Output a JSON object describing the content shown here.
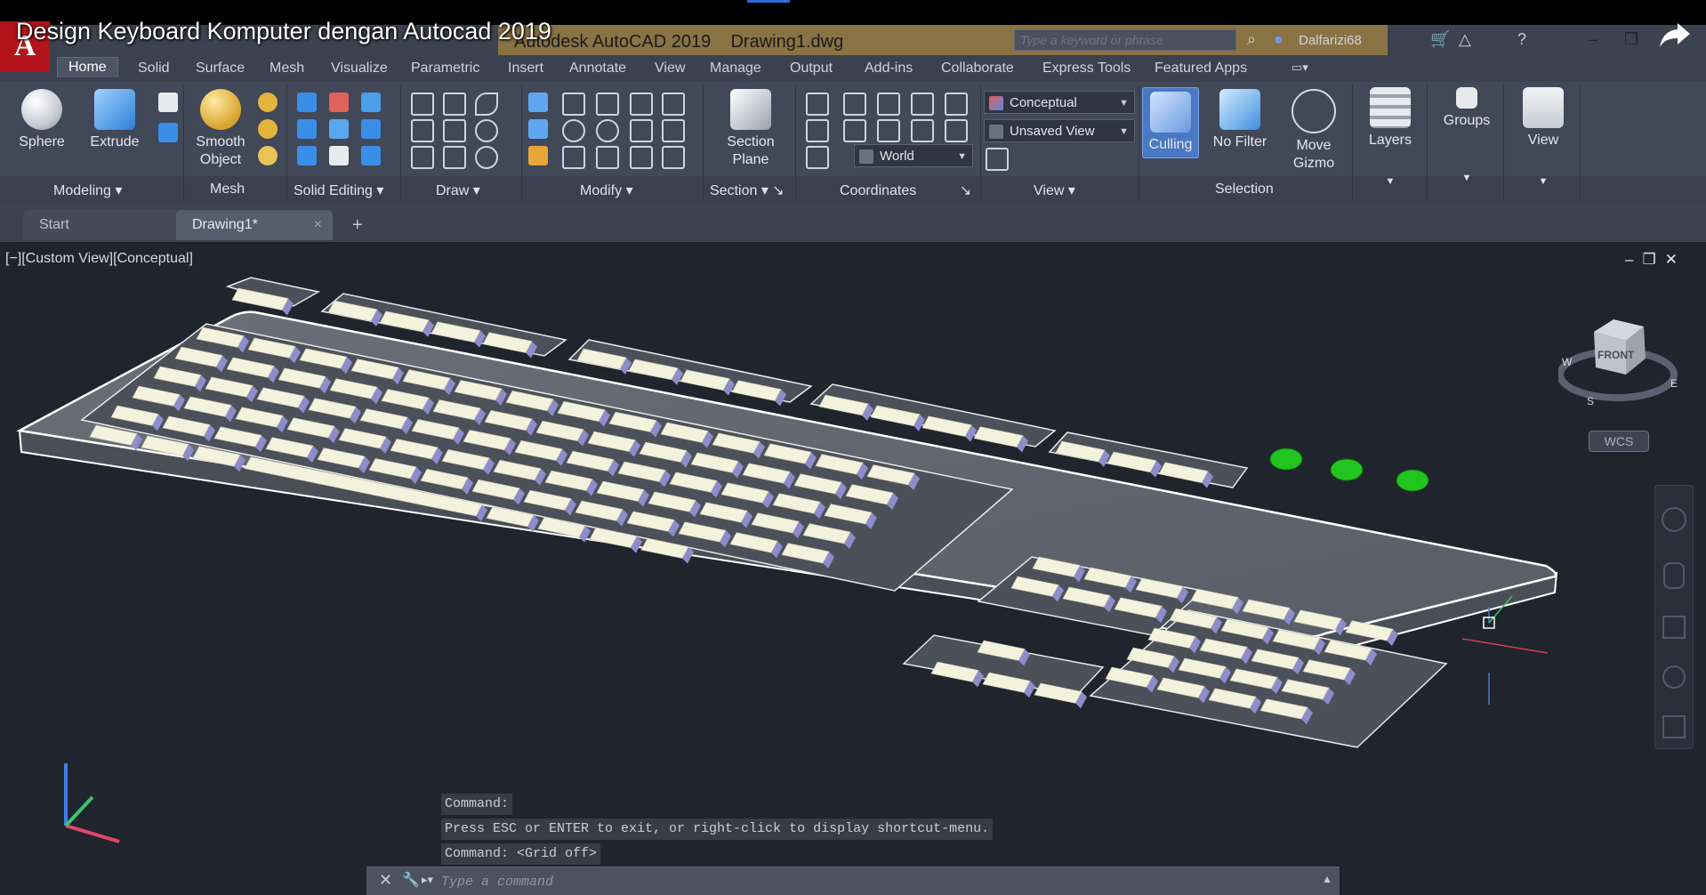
{
  "video": {
    "title": "Design Keyboard Komputer dengan Autocad 2019"
  },
  "titlebar": {
    "app_title": "Autodesk AutoCAD 2019    Drawing1.dwg",
    "search_placeholder": "Type a keyword or phrase",
    "user": "Dalfarizi68"
  },
  "ribbon": {
    "tabs": [
      "Home",
      "Solid",
      "Surface",
      "Mesh",
      "Visualize",
      "Parametric",
      "Insert",
      "Annotate",
      "View",
      "Manage",
      "Output",
      "Add-ins",
      "Collaborate",
      "Express Tools",
      "Featured Apps"
    ],
    "active_tab": "Home",
    "buttons": {
      "sphere": "Sphere",
      "extrude": "Extrude",
      "smooth_object_1": "Smooth",
      "smooth_object_2": "Object",
      "section_plane_1": "Section",
      "section_plane_2": "Plane",
      "culling": "Culling",
      "no_filter": "No Filter",
      "move_gizmo_1": "Move",
      "move_gizmo_2": "Gizmo",
      "layers": "Layers",
      "groups": "Groups",
      "view": "View"
    },
    "dropdowns": {
      "visual_style": "Conceptual",
      "named_view": "Unsaved View",
      "ucs": "World"
    },
    "panels": [
      "Modeling",
      "Mesh",
      "Solid Editing",
      "Draw",
      "Modify",
      "Section",
      "Coordinates",
      "View",
      "Selection"
    ]
  },
  "file_tabs": {
    "start": "Start",
    "drawing": "Drawing1*",
    "add": "+"
  },
  "viewport": {
    "label": "[−][Custom View][Conceptual]",
    "viewcube_face": "FRONT",
    "compass": {
      "w": "W",
      "s": "S",
      "e": "E"
    },
    "wcs": "WCS"
  },
  "command": {
    "history": [
      "Command:",
      "Press ESC or ENTER to exit, or right-click to display shortcut-menu.",
      "Command:  <Grid off>"
    ],
    "placeholder": "Type a command"
  },
  "colors": {
    "accent": "#3a6fcb",
    "keycap": "#f3f2dc",
    "keycap_shade": "#8f8ccc",
    "led": "#22c41f",
    "logo": "#b3141b"
  }
}
